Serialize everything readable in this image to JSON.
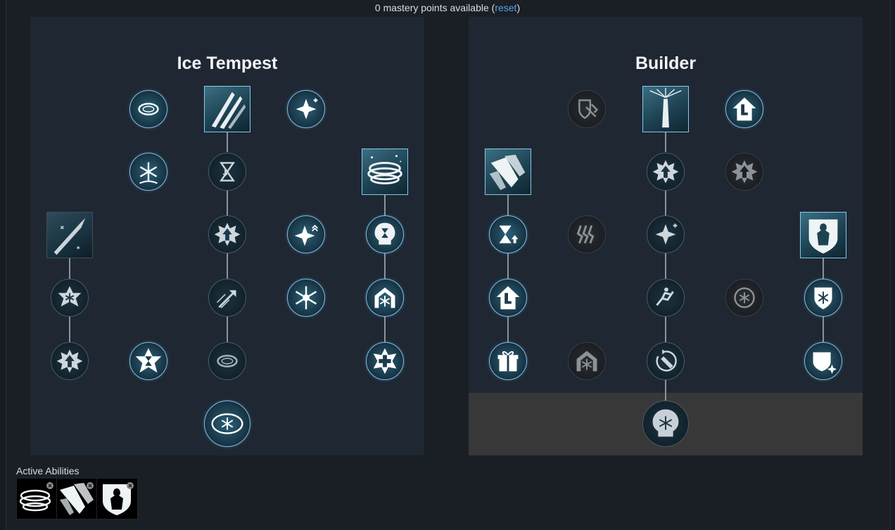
{
  "header": {
    "points_text": "0 mastery points available (",
    "reset_label": "reset",
    "close_paren": ")"
  },
  "trees": [
    {
      "title": "Ice Tempest"
    },
    {
      "title": "Builder"
    }
  ],
  "active_abilities": {
    "label": "Active Abilities",
    "items": [
      "ice-storm-icon",
      "ice-shards-icon",
      "frozen-figure-shield-icon"
    ]
  },
  "colors": {
    "active_border": "#7dbfe6",
    "panel": "#1f2733",
    "link": "#5aa0e8"
  }
}
